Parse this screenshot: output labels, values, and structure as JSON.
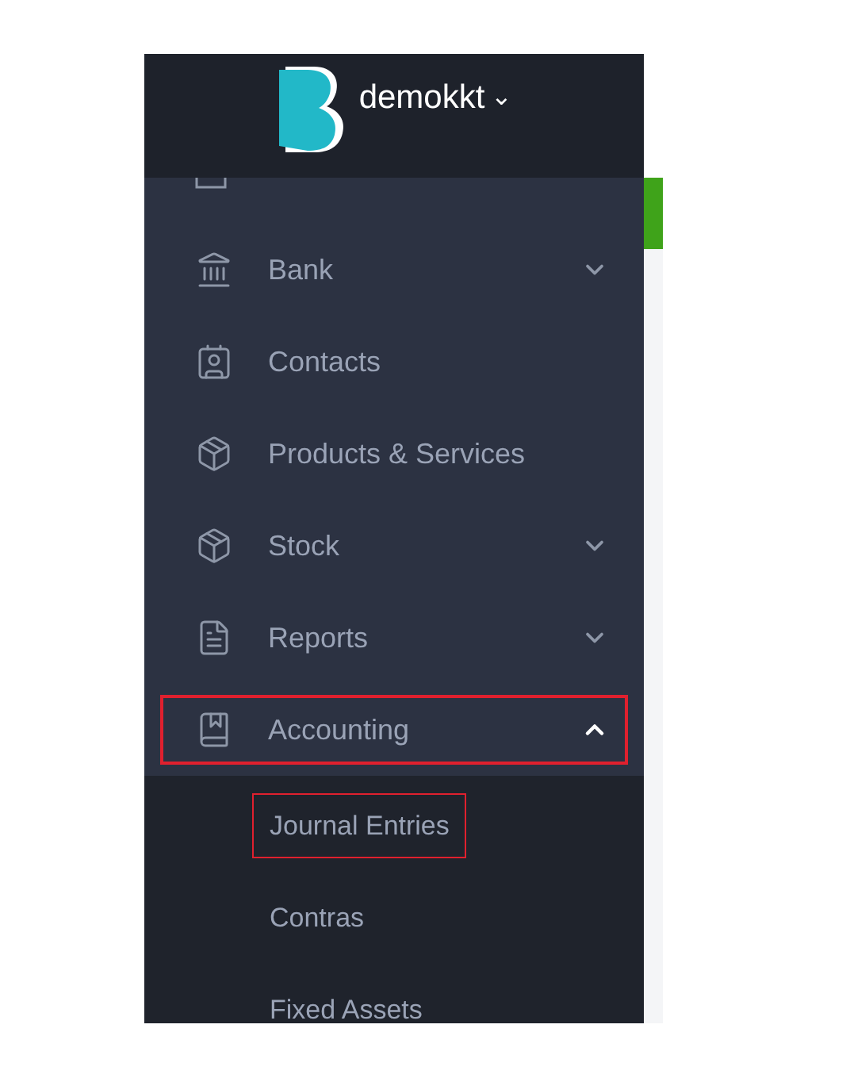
{
  "header": {
    "company": "demokkt",
    "dropdown_caret": "⌄"
  },
  "menu": [
    {
      "label": "Bank",
      "kind": "bank",
      "expanded": false,
      "highlighted": false
    },
    {
      "label": "Contacts",
      "kind": "contacts",
      "highlighted": false
    },
    {
      "label": "Products & Services",
      "kind": "box",
      "highlighted": false
    },
    {
      "label": "Stock",
      "kind": "box",
      "expanded": false,
      "highlighted": false
    },
    {
      "label": "Reports",
      "kind": "report",
      "expanded": false,
      "highlighted": false
    },
    {
      "label": "Accounting",
      "kind": "book",
      "expanded": true,
      "highlighted": true,
      "children": [
        {
          "label": "Journal Entries",
          "highlighted": true
        },
        {
          "label": "Contras",
          "highlighted": false
        },
        {
          "label": "Fixed Assets",
          "highlighted": false
        }
      ]
    }
  ]
}
